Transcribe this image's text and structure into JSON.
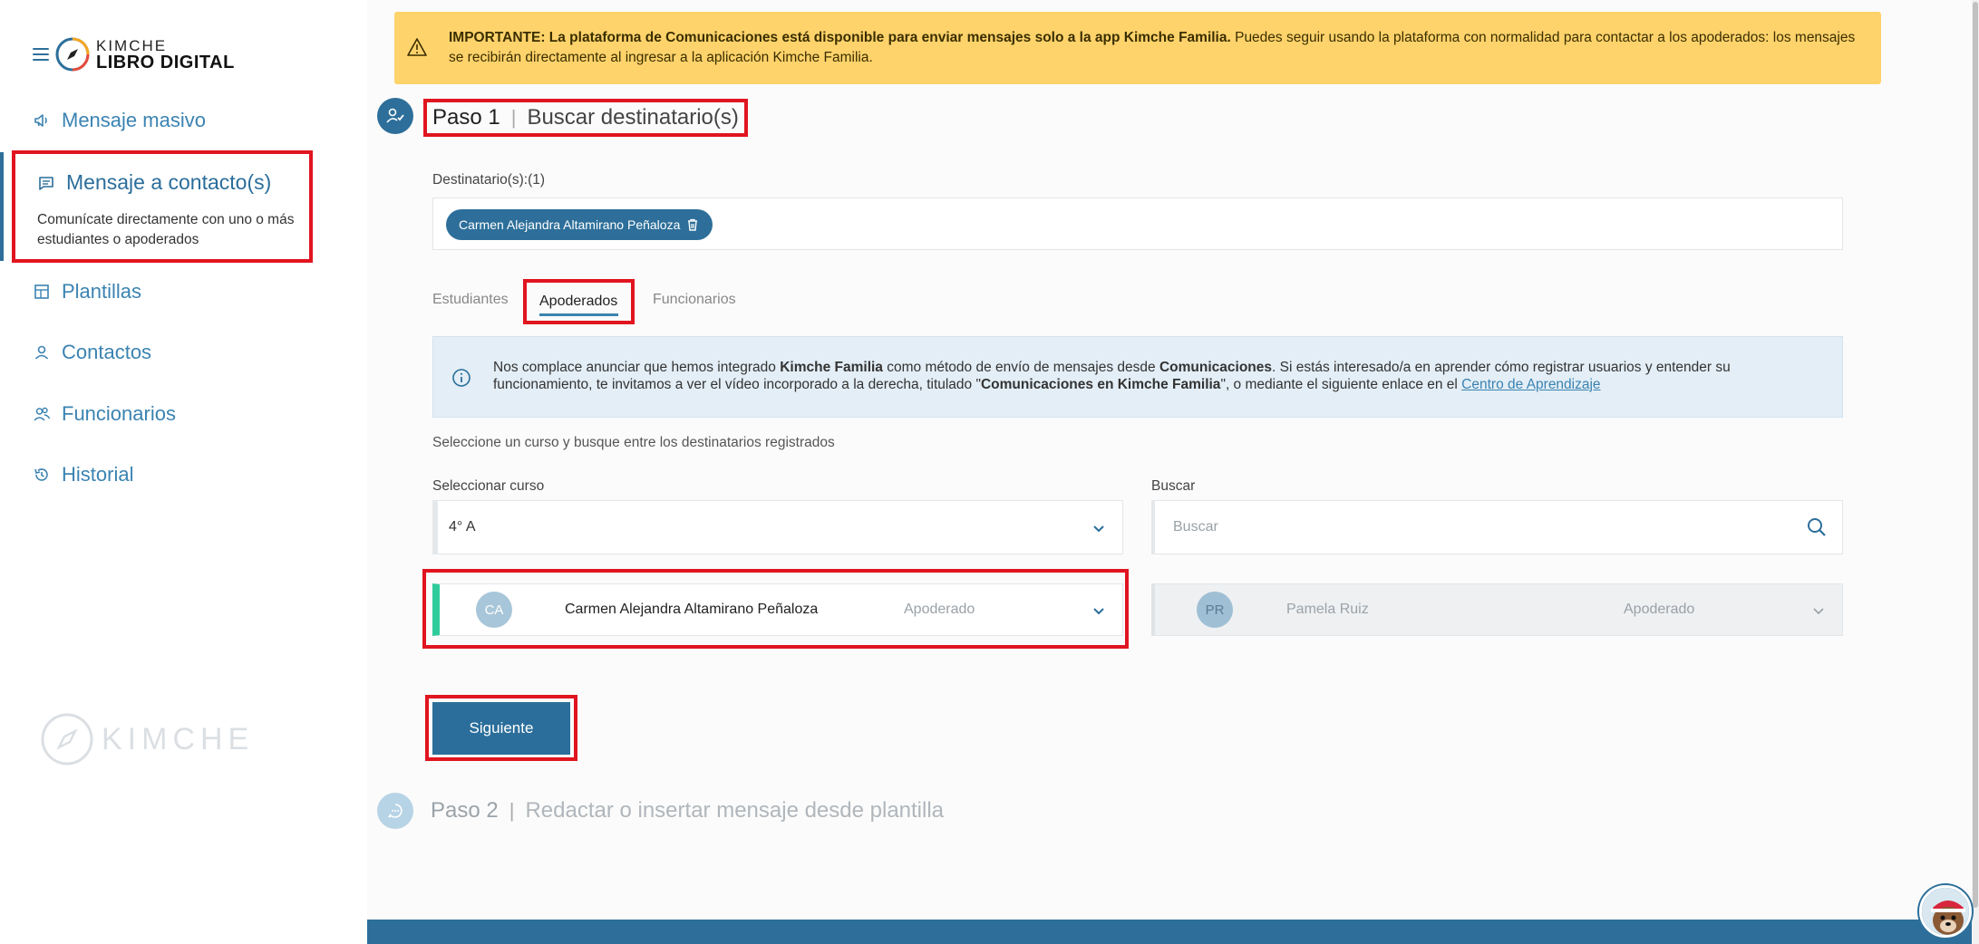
{
  "sidebar": {
    "logo": {
      "top": "KIMCHE",
      "bottom": "LIBRO DIGITAL"
    },
    "items": [
      {
        "label": "Mensaje masivo",
        "icon": "megaphone-icon"
      },
      {
        "label": "Mensaje a contacto(s)",
        "icon": "message-icon",
        "description": "Comunícate directamente con uno o más estudiantes o apoderados",
        "active": true
      },
      {
        "label": "Plantillas",
        "icon": "template-icon"
      },
      {
        "label": "Contactos",
        "icon": "person-icon"
      },
      {
        "label": "Funcionarios",
        "icon": "people-icon"
      },
      {
        "label": "Historial",
        "icon": "history-icon"
      }
    ],
    "watermark": "KIMCHE"
  },
  "alert": {
    "strong": "IMPORTANTE: La plataforma de Comunicaciones está disponible para enviar mensajes solo a la app Kimche Familia.",
    "text": " Puedes seguir usando la plataforma con normalidad para contactar a los apoderados: los mensajes se recibirán directamente al ingresar a la aplicación Kimche Familia."
  },
  "step1": {
    "number": "Paso 1",
    "title": "Buscar destinatario(s)"
  },
  "recipients": {
    "label": "Destinatario(s):(1)",
    "chips": [
      "Carmen Alejandra Altamirano Peñaloza"
    ]
  },
  "tabs": [
    "Estudiantes",
    "Apoderados",
    "Funcionarios"
  ],
  "info": {
    "t1": "Nos complace anunciar que hemos integrado ",
    "b1": "Kimche Familia",
    "t2": " como método de envío de mensajes desde ",
    "b2": "Comunicaciones",
    "t3": ". Si estás interesado/a en aprender cómo registrar usuarios y entender su funcionamiento, te invitamos a ver el vídeo incorporado a la derecha, titulado \"",
    "b3": "Comunicaciones en Kimche Familia",
    "t4": "\", o mediante el siguiente enlace en el ",
    "link": "Centro de Aprendizaje"
  },
  "select_hint": "Seleccione un curso y busque entre los destinatarios registrados",
  "course": {
    "label": "Seleccionar curso",
    "value": "4° A"
  },
  "search": {
    "label": "Buscar",
    "placeholder": "Buscar"
  },
  "cards": [
    {
      "initials": "CA",
      "name": "Carmen Alejandra Altamirano Peñaloza",
      "role": "Apoderado",
      "selected": true
    },
    {
      "initials": "PR",
      "name": "Pamela Ruiz",
      "role": "Apoderado",
      "selected": false
    }
  ],
  "next_button": "Siguiente",
  "step2": {
    "number": "Paso 2",
    "title": "Redactar o insertar mensaje desde plantilla"
  },
  "colors": {
    "primary": "#2d6f9a",
    "highlight": "#e0151f",
    "alert": "#ffd36b",
    "selected": "#2ecc9b"
  }
}
